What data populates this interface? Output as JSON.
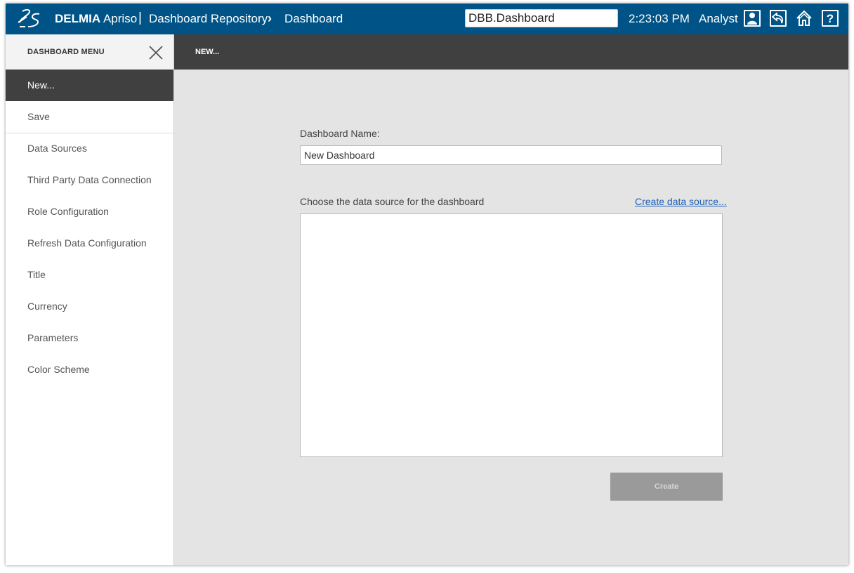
{
  "topbar": {
    "brand_bold": "DELMIA",
    "brand_light": "Apriso",
    "separator": "|",
    "breadcrumb_parent": "Dashboard Repository",
    "breadcrumb_arrow": "›",
    "breadcrumb_current": "Dashboard",
    "search_value": "DBB.Dashboard",
    "clock": "2:23:03 PM",
    "user": "Analyst",
    "help_glyph": "?",
    "icons": [
      "ds-logo-icon",
      "user-icon",
      "back-icon",
      "home-icon",
      "help-icon"
    ],
    "bar_color": "#005386"
  },
  "sidebar": {
    "title": "DASHBOARD MENU",
    "close_icon": "close-icon",
    "items": [
      {
        "label": "New...",
        "active": true
      },
      {
        "label": "Save"
      },
      {
        "label": "Data Sources"
      },
      {
        "label": "Third Party Data Connection"
      },
      {
        "label": "Role Configuration"
      },
      {
        "label": "Refresh Data Configuration"
      },
      {
        "label": "Title"
      },
      {
        "label": "Currency"
      },
      {
        "label": "Parameters"
      },
      {
        "label": "Color Scheme"
      }
    ]
  },
  "main": {
    "header_title": "NEW...",
    "name_label": "Dashboard Name:",
    "name_value": "New Dashboard",
    "datasource_label": "Choose the data source for the dashboard",
    "create_datasource_link": "Create data source...",
    "create_button": "Create"
  }
}
